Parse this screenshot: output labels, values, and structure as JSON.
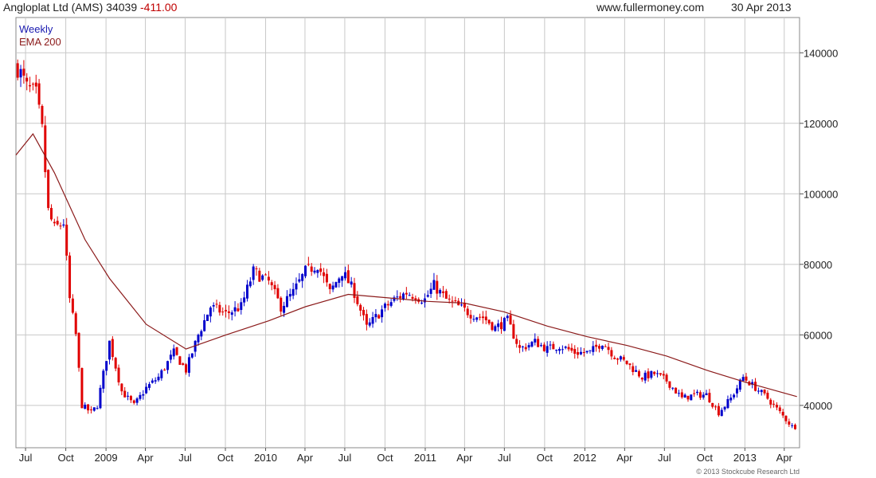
{
  "header": {
    "instrument": "Angloplat Ltd (AMS) 34039",
    "change": "-411.00",
    "site": "www.fullermoney.com",
    "date": "30 Apr 2013"
  },
  "legend": {
    "series1": "Weekly",
    "series2": "EMA 200"
  },
  "copyright": "© 2013 Stockcube Research Ltd",
  "colors": {
    "up": "#0000cc",
    "down": "#e00000",
    "ema": "#8b1a1a",
    "grid": "#c8c8c8"
  },
  "chart_data": {
    "type": "candlestick",
    "x_tick_labels": [
      "Jul",
      "Oct",
      "2009",
      "Apr",
      "Jul",
      "Oct",
      "2010",
      "Apr",
      "Jul",
      "Oct",
      "2011",
      "Apr",
      "Jul",
      "Oct",
      "2012",
      "Apr",
      "Jul",
      "Oct",
      "2013",
      "Apr"
    ],
    "y_tick_labels": [
      "40000",
      "60000",
      "80000",
      "100000",
      "120000",
      "140000"
    ],
    "y_ticks": [
      40000,
      60000,
      80000,
      100000,
      120000,
      140000
    ],
    "ylim": [
      28000,
      150000
    ],
    "x_range": [
      "2008-06-09",
      "2013-05-06"
    ],
    "grid": true,
    "weekly_close_approx": [
      [
        "2008-06-13",
        136000
      ],
      [
        "2008-07-04",
        130000
      ],
      [
        "2008-07-25",
        128000
      ],
      [
        "2008-08-08",
        118000
      ],
      [
        "2008-08-22",
        95000
      ],
      [
        "2008-09-05",
        90000
      ],
      [
        "2008-09-26",
        92000
      ],
      [
        "2008-10-10",
        70000
      ],
      [
        "2008-10-24",
        60000
      ],
      [
        "2008-11-07",
        40000
      ],
      [
        "2008-11-28",
        38000
      ],
      [
        "2008-12-12",
        40000
      ],
      [
        "2009-01-09",
        58000
      ],
      [
        "2009-02-06",
        44000
      ],
      [
        "2009-03-06",
        40000
      ],
      [
        "2009-04-03",
        45000
      ],
      [
        "2009-05-01",
        48000
      ],
      [
        "2009-06-05",
        55000
      ],
      [
        "2009-07-03",
        50000
      ],
      [
        "2009-07-31",
        60000
      ],
      [
        "2009-08-28",
        68000
      ],
      [
        "2009-10-02",
        66000
      ],
      [
        "2009-11-06",
        68000
      ],
      [
        "2009-12-04",
        78000
      ],
      [
        "2010-01-08",
        75000
      ],
      [
        "2010-02-05",
        68000
      ],
      [
        "2010-03-05",
        72000
      ],
      [
        "2010-04-02",
        78000
      ],
      [
        "2010-04-30",
        80000
      ],
      [
        "2010-05-28",
        72000
      ],
      [
        "2010-06-25",
        78000
      ],
      [
        "2010-07-23",
        72000
      ],
      [
        "2010-08-20",
        62000
      ],
      [
        "2010-09-24",
        67000
      ],
      [
        "2010-10-22",
        70000
      ],
      [
        "2010-11-19",
        72000
      ],
      [
        "2010-12-31",
        70000
      ],
      [
        "2011-01-21",
        74000
      ],
      [
        "2011-02-18",
        70000
      ],
      [
        "2011-03-18",
        68000
      ],
      [
        "2011-04-15",
        66000
      ],
      [
        "2011-05-13",
        65000
      ],
      [
        "2011-06-10",
        62000
      ],
      [
        "2011-07-08",
        64000
      ],
      [
        "2011-08-05",
        56000
      ],
      [
        "2011-09-09",
        58000
      ],
      [
        "2011-10-07",
        56000
      ],
      [
        "2011-11-04",
        57000
      ],
      [
        "2011-12-09",
        55000
      ],
      [
        "2012-01-13",
        55000
      ],
      [
        "2012-02-10",
        58000
      ],
      [
        "2012-03-09",
        54000
      ],
      [
        "2012-04-06",
        52000
      ],
      [
        "2012-05-11",
        48000
      ],
      [
        "2012-06-08",
        49000
      ],
      [
        "2012-07-06",
        47000
      ],
      [
        "2012-08-10",
        42000
      ],
      [
        "2012-09-07",
        43000
      ],
      [
        "2012-10-05",
        43000
      ],
      [
        "2012-11-02",
        38000
      ],
      [
        "2012-11-30",
        42000
      ],
      [
        "2012-12-28",
        48000
      ],
      [
        "2013-01-25",
        45000
      ],
      [
        "2013-02-22",
        42000
      ],
      [
        "2013-03-22",
        38000
      ],
      [
        "2013-04-19",
        34000
      ],
      [
        "2013-04-30",
        34039
      ]
    ],
    "ema_200_approx": [
      [
        "2008-06-09",
        111000
      ],
      [
        "2008-07-18",
        117000
      ],
      [
        "2008-09-05",
        106000
      ],
      [
        "2008-11-14",
        87000
      ],
      [
        "2009-01-09",
        76000
      ],
      [
        "2009-04-03",
        63000
      ],
      [
        "2009-07-03",
        56000
      ],
      [
        "2009-10-02",
        60000
      ],
      [
        "2010-01-08",
        64000
      ],
      [
        "2010-04-02",
        68000
      ],
      [
        "2010-07-09",
        71500
      ],
      [
        "2010-10-08",
        70500
      ],
      [
        "2011-01-07",
        69500
      ],
      [
        "2011-04-01",
        69000
      ],
      [
        "2011-07-01",
        66500
      ],
      [
        "2011-10-07",
        62500
      ],
      [
        "2012-01-06",
        59500
      ],
      [
        "2012-04-06",
        57000
      ],
      [
        "2012-07-06",
        54000
      ],
      [
        "2012-10-05",
        50000
      ],
      [
        "2013-01-04",
        46500
      ],
      [
        "2013-04-30",
        42500
      ]
    ]
  }
}
